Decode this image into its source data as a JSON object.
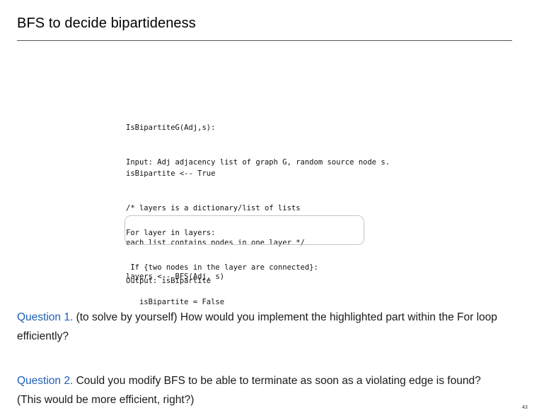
{
  "title": "BFS to decide bipartideness",
  "code": {
    "block1": [
      "IsBipartiteG(Adj,s):",
      "Input: Adj adjacency list of graph G, random source node s."
    ],
    "block2": [
      "isBipartite <-- True",
      "/* layers is a dictionary/list of lists",
      "each list contains nodes in one layer */",
      "layers <-- BFS(Adj, s)"
    ],
    "block3": [
      "For layer in layers:",
      " If {two nodes in the layer are connected}:",
      "   isBipartite = False"
    ],
    "block4": [
      "Output: isBipartite"
    ]
  },
  "questions": [
    {
      "label": "Question 1.",
      "text": " (to solve by yourself) How would you implement the highlighted part within the For loop efficiently?"
    },
    {
      "label": "Question 2.",
      "text": " Could you modify BFS to be able to terminate as soon as a violating edge is found? (This would be more efficient, right?)"
    }
  ],
  "page_number": "43",
  "colors": {
    "question_label": "#1f5eb8",
    "highlight_border": "#c6c6c6"
  }
}
